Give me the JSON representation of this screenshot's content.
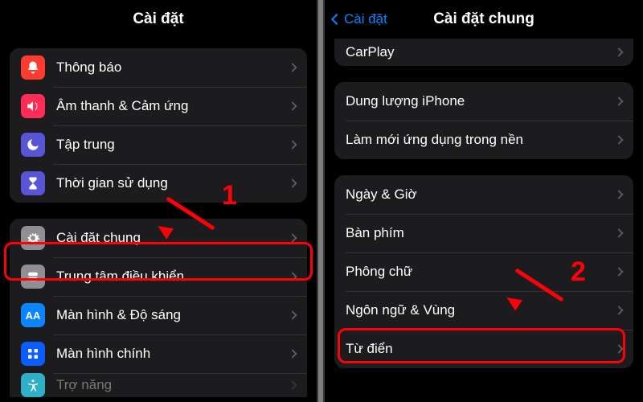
{
  "left": {
    "title": "Cài đặt",
    "group1": [
      {
        "label": "Thông báo"
      },
      {
        "label": "Âm thanh & Cảm ứng"
      },
      {
        "label": "Tập trung"
      },
      {
        "label": "Thời gian sử dụng"
      }
    ],
    "group2": [
      {
        "label": "Cài đặt chung"
      },
      {
        "label": "Trung tâm điều khiển"
      },
      {
        "label": "Màn hình & Độ sáng"
      },
      {
        "label": "Màn hình chính"
      },
      {
        "label": "Trợ năng"
      }
    ]
  },
  "right": {
    "back": "Cài đặt",
    "title": "Cài đặt chung",
    "group_peek": [
      {
        "label": "CarPlay"
      }
    ],
    "group1": [
      {
        "label": "Dung lượng iPhone"
      },
      {
        "label": "Làm mới ứng dụng trong nền"
      }
    ],
    "group2": [
      {
        "label": "Ngày & Giờ"
      },
      {
        "label": "Bàn phím"
      },
      {
        "label": "Phông chữ"
      },
      {
        "label": "Ngôn ngữ & Vùng"
      },
      {
        "label": "Từ điển"
      }
    ]
  },
  "annotations": {
    "n1": "1",
    "n2": "2"
  }
}
